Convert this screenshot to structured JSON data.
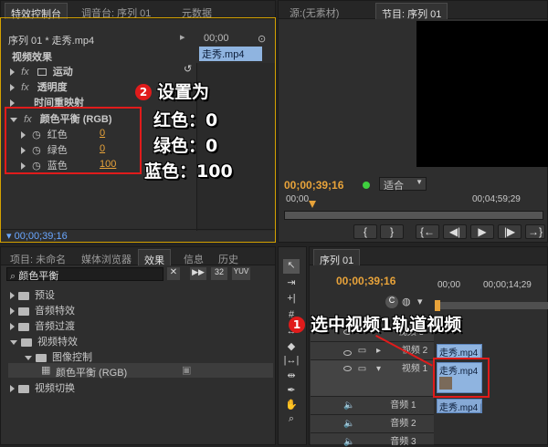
{
  "effect_controls": {
    "tabs": [
      "特效控制台",
      "调音台: 序列 01",
      "元数据"
    ],
    "header_title": "序列 01 * 走秀.mp4",
    "header_time": "00;00",
    "clip_label": "走秀.mp4",
    "section": "视频效果",
    "items": {
      "motion": "运动",
      "opacity": "透明度",
      "time_remap": "时间重映射",
      "color_balance": "颜色平衡 (RGB)"
    },
    "params": [
      {
        "label": "红色",
        "value": "0"
      },
      {
        "label": "绿色",
        "value": "0"
      },
      {
        "label": "蓝色",
        "value": "100"
      }
    ],
    "timecode": "00;00;39;16"
  },
  "program_monitor": {
    "tabs": [
      "源:(无素材)",
      "节目: 序列 01"
    ],
    "timecode": "00;00;39;16",
    "fit": "适合",
    "ruler_start": "00;00",
    "ruler_end": "00;04;59;29",
    "buttons": [
      "{",
      "}",
      "{←",
      "◀|",
      "▶",
      "|▶",
      "→}"
    ]
  },
  "project": {
    "tabs": [
      "项目: 未命名",
      "媒体浏览器",
      "效果",
      "信息",
      "历史"
    ],
    "search_value": "颜色平衡",
    "icons": [
      "32",
      "YUV"
    ],
    "tree": {
      "presets": "预设",
      "audio_effects": "音频特效",
      "audio_transitions": "音频过渡",
      "video_effects": "视频特效",
      "image_control": "图像控制",
      "color_balance": "颜色平衡 (RGB)",
      "video_transitions": "视频切换"
    }
  },
  "timeline": {
    "tab": "序列 01",
    "timecode": "00;00;39;16",
    "ruler_start": "00;00",
    "ruler_mark": "00;00;14;29",
    "video_tracks": [
      "视频 3",
      "视频 2",
      "视频 1"
    ],
    "audio_tracks": [
      "音频 1",
      "音频 2",
      "音频 3"
    ],
    "clips": {
      "v2": "走秀.mp4 [",
      "v1": "走秀.mp4",
      "a1": "走秀.mp4 ["
    }
  },
  "annotations": {
    "step2_number": "2",
    "step2_title": "设置为",
    "step2_lines": [
      "红色：0",
      "绿色：0",
      "蓝色：100"
    ],
    "step1_number": "1",
    "step1_text": "选中视频1轨道视频"
  },
  "colors": {
    "highlight_frame": "#d4a100",
    "annotation_red": "#e01b1b",
    "value_orange": "#e8a33a",
    "clip_blue": "#8fb4e0"
  }
}
